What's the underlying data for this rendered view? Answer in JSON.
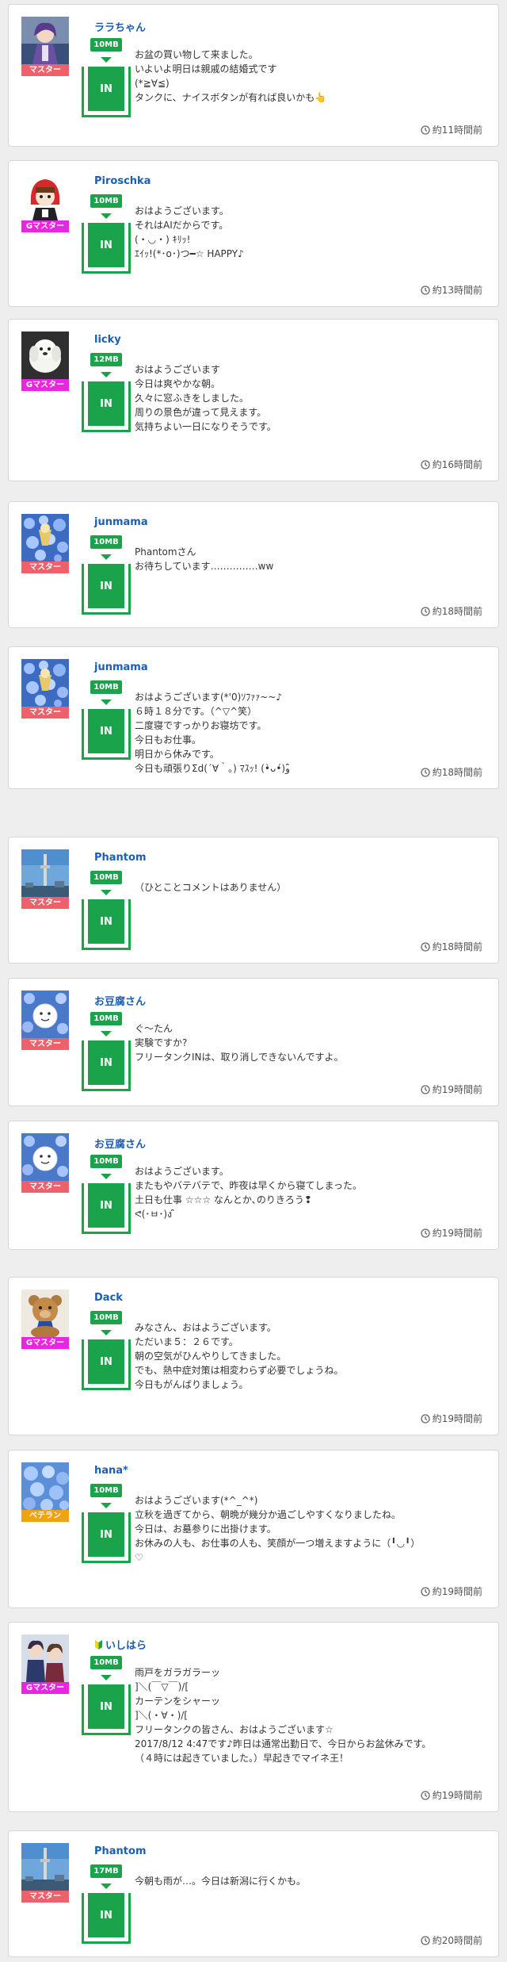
{
  "posts": [
    {
      "name": "ララちゃん",
      "rank": "マスター",
      "rank_type": "master",
      "avatar": "anime-girl-avatar",
      "size": "10MB",
      "tank_label": "IN",
      "lines": [
        "お盆の買い物して来ました。",
        "いよいよ明日は親戚の結婚式です",
        "(*≧∀≦)",
        "タンクに、ナイスボタンが有れば良いかも👆"
      ],
      "time": "約11時間前"
    },
    {
      "name": "Piroschka",
      "rank": "Gマスター",
      "rank_type": "gmaster",
      "avatar": "red-hood-girl-avatar",
      "size": "10MB",
      "tank_label": "IN",
      "lines": [
        "おはようございます。",
        "それはAIだからです。",
        "(・◡・) ｷﾘｯ!",
        "ｴｲｯ!(*･o･)つ━☆ HAPPY♪"
      ],
      "time": "約13時間前"
    },
    {
      "name": "licky",
      "rank": "Gマスター",
      "rank_type": "gmaster",
      "avatar": "white-dog-avatar",
      "size": "12MB",
      "tank_label": "IN",
      "lines": [
        "おはようございます",
        "今日は爽やかな朝。",
        "久々に窓ふきをしました。",
        "周りの景色が違って見えます。",
        "気持ちよい一日になりそうです。"
      ],
      "time": "約16時間前"
    },
    {
      "name": "junmama",
      "rank": "マスター",
      "rank_type": "master",
      "avatar": "blue-flowers-avatar",
      "size": "10MB",
      "tank_label": "IN",
      "lines": [
        "Phantomさん",
        "お待ちしています……………ww"
      ],
      "time": "約18時間前"
    },
    {
      "name": "junmama",
      "rank": "マスター",
      "rank_type": "master",
      "avatar": "blue-flowers-avatar",
      "size": "10MB",
      "tank_label": "IN",
      "lines": [
        "おはようございます(*'0)ｿﾌｧｧ~~♪",
        "６時１８分です。（^▽^笑）",
        "二度寝ですっかりお寝坊です。",
        "今日もお仕事。",
        "明日から休みです。",
        "今日も頑張りΣd(´∀｀｡) ﾏｽｯ! (•̀ᴗ•́)و ̑̑"
      ],
      "time": "約18時間前"
    },
    {
      "name": "Phantom",
      "rank": "マスター",
      "rank_type": "master",
      "avatar": "tower-sky-avatar",
      "size": "10MB",
      "tank_label": "IN",
      "lines": [
        "（ひとことコメントはありません）"
      ],
      "time": "約18時間前"
    },
    {
      "name": "お豆腐さん",
      "rank": "マスター",
      "rank_type": "master",
      "avatar": "tofu-flowers-avatar",
      "size": "10MB",
      "tank_label": "IN",
      "lines": [
        "ぐ〜たん",
        "実験ですか?",
        "フリータンクINは、取り消しできないんですよ。"
      ],
      "time": "約19時間前"
    },
    {
      "name": "お豆腐さん",
      "rank": "マスター",
      "rank_type": "master",
      "avatar": "tofu-flowers-avatar",
      "size": "10MB",
      "tank_label": "IN",
      "lines": [
        "おはようございます。",
        "またもやバテバテで、昨夜は早くから寝てしまった。",
        "土日も仕事 ☆☆☆ なんとか､のりきろう❢",
        "ᕙ(･ㅂ･)ง ̑̑"
      ],
      "time": "約19時間前"
    },
    {
      "name": "Dack",
      "rank": "Gマスター",
      "rank_type": "gmaster",
      "avatar": "teddy-bear-avatar",
      "size": "10MB",
      "tank_label": "IN",
      "lines": [
        "みなさん、おはようございます。",
        "ただいま５：２６です。",
        "朝の空気がひんやりしてきました。",
        "でも、熱中症対策は相変わらず必要でしょうね。",
        "今日もがんばりましょう。"
      ],
      "time": "約19時間前"
    },
    {
      "name": "hana*",
      "rank": "ベテラン",
      "rank_type": "veteran",
      "avatar": "blue-flower-sea-avatar",
      "size": "10MB",
      "tank_label": "IN",
      "lines": [
        "おはようございます(*^_^*)",
        "立秋を過ぎてから、朝晩が幾分か過ごしやすくなりましたね。",
        "今日は、お墓参りに出掛けます。",
        "お休みの人も、お仕事の人も、笑顔が一つ増えますように（╹◡╹）",
        "♡"
      ],
      "time": "約19時間前"
    },
    {
      "name": "いしはら",
      "rank": "Gマスター",
      "rank_type": "gmaster",
      "avatar": "anime-group-avatar",
      "beginner_icon": "beginner-mark-icon",
      "size": "10MB",
      "tank_label": "IN",
      "lines": [
        "雨戸をガラガラーッ",
        "]＼(￣▽￣)/[",
        "カーテンをシャーッ",
        "]＼(・∀・)/[",
        "フリータンクの皆さん、おはようございます☆",
        "2017/8/12 4:47です♪昨日は通常出勤日で、今日からお盆休みです。",
        "（４時には起きていました。）早起きでマイネ王！"
      ],
      "time": "約19時間前"
    },
    {
      "name": "Phantom",
      "rank": "マスター",
      "rank_type": "master",
      "avatar": "tower-sky-avatar",
      "size": "17MB",
      "tank_label": "IN",
      "lines": [
        "今朝も雨が…。今日は新潟に行くかも。"
      ],
      "time": "約20時間前"
    }
  ],
  "colors": {
    "name": "#1a5fb4",
    "tank": "#1aa34a",
    "master": "#f0606b",
    "gmaster": "#e825e0",
    "veteran": "#f2a20f"
  },
  "icons": {
    "time": "clock-icon",
    "arrow": "arrow-down-icon"
  }
}
